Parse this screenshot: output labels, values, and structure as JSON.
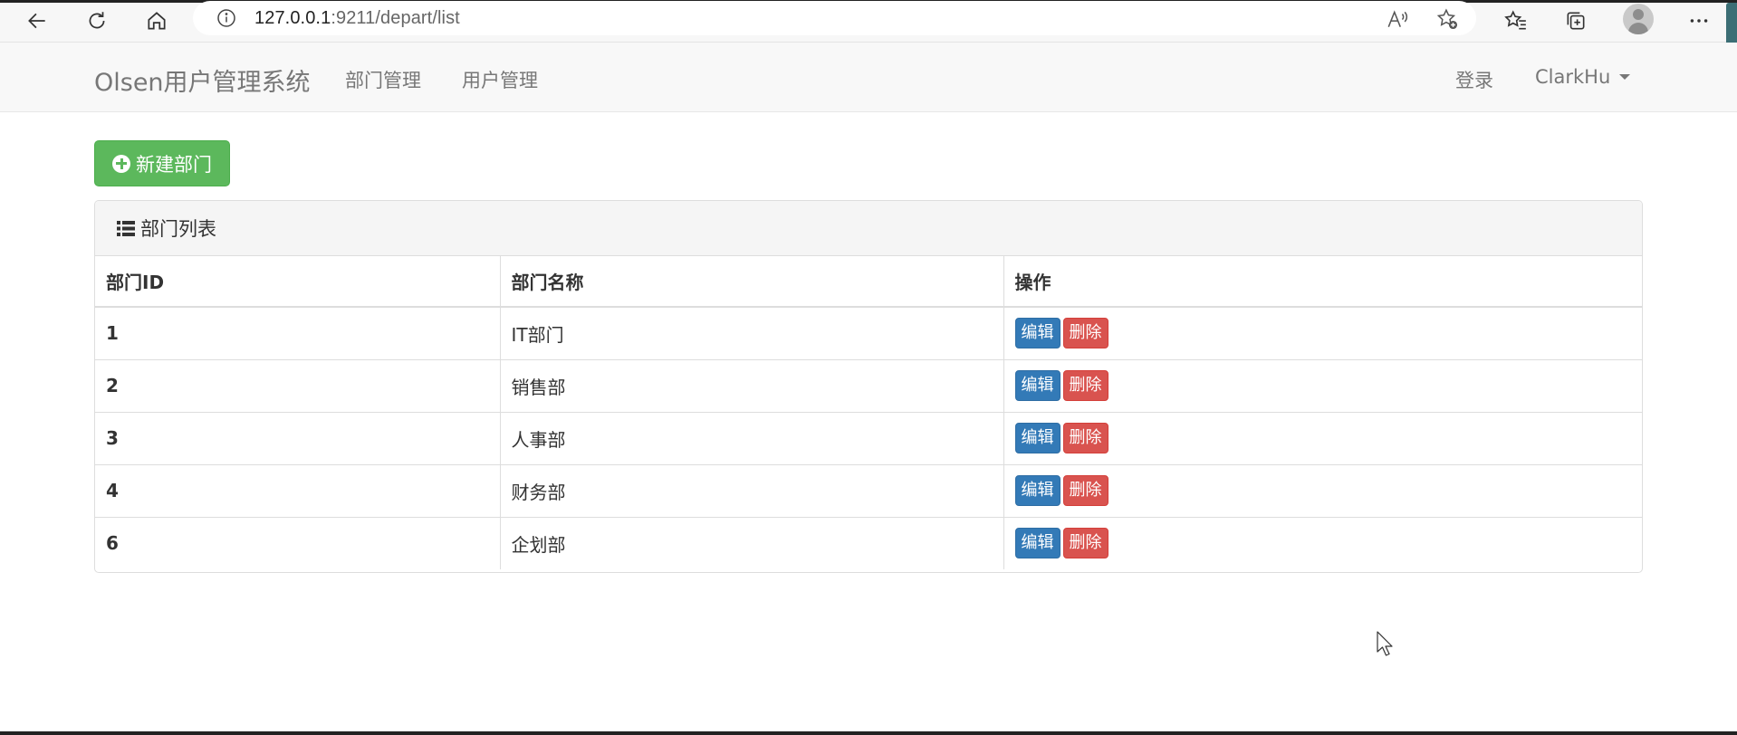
{
  "browser": {
    "url_host": "127.0.0.1",
    "url_path": ":9211/depart/list",
    "icons": [
      "back-icon",
      "refresh-icon",
      "home-icon",
      "info-icon",
      "read-aloud-icon",
      "add-favorite-icon",
      "favorites-icon",
      "collections-icon",
      "profile-icon",
      "more-icon"
    ]
  },
  "navbar": {
    "brand": "Olsen用户管理系统",
    "links": [
      "部门管理",
      "用户管理"
    ],
    "login": "登录",
    "user": "ClarkHu"
  },
  "toolbar": {
    "new_label": "新建部门"
  },
  "panel": {
    "title": "部门列表",
    "columns": [
      "部门ID",
      "部门名称",
      "操作"
    ],
    "rows": [
      {
        "id": "1",
        "name": "IT部门"
      },
      {
        "id": "2",
        "name": "销售部"
      },
      {
        "id": "3",
        "name": "人事部"
      },
      {
        "id": "4",
        "name": "财务部"
      },
      {
        "id": "6",
        "name": "企划部"
      }
    ],
    "edit_label": "编辑",
    "delete_label": "删除"
  },
  "colors": {
    "success": "#5cb85c",
    "primary": "#337ab7",
    "danger": "#d9534f"
  }
}
